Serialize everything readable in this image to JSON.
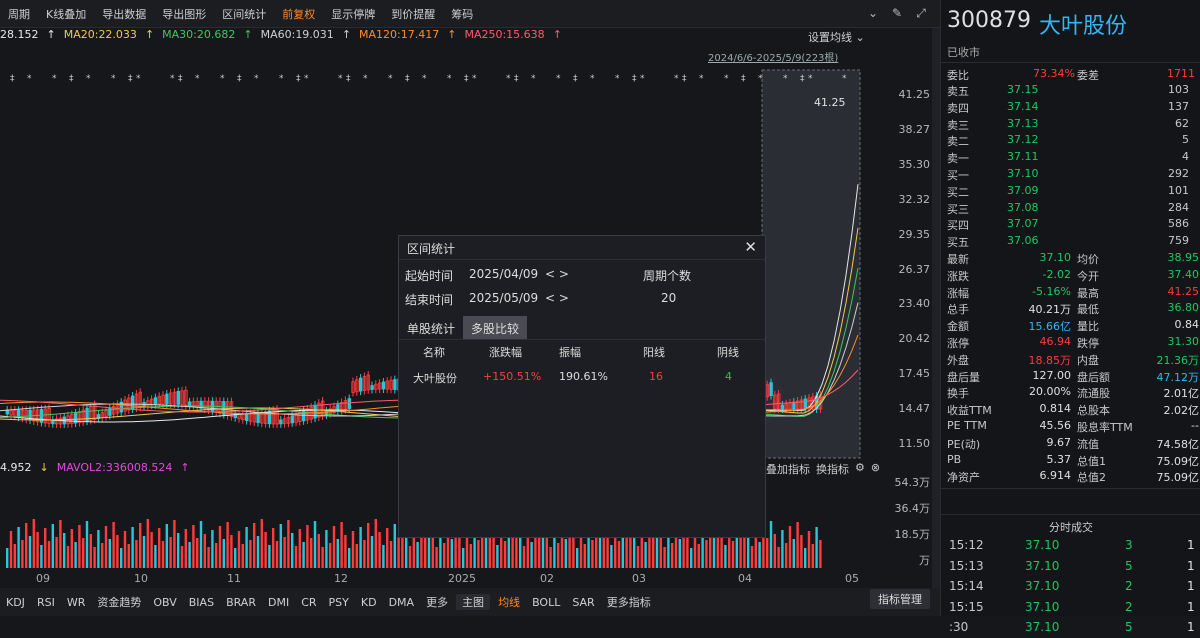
{
  "toolbar": {
    "items": [
      "周期",
      "K线叠加",
      "导出数据",
      "导出图形",
      "区间统计",
      "前复权",
      "显示停牌",
      "到价提醒",
      "筹码"
    ],
    "active_index": 5
  },
  "ma": [
    {
      "label": ":28.152",
      "color": "#e8e8e8"
    },
    {
      "label": "↑ MA20:22.033",
      "color": "#f2c94c"
    },
    {
      "label": "↑ MA30:20.682",
      "color": "#e24bd8"
    },
    {
      "label": "↑ MA30:20.682",
      "color": "#3ec95c"
    },
    {
      "label": "↑ MA60:19.031",
      "color": "#d0d0d0"
    },
    {
      "label": "↑ MA120:17.417",
      "color": "#ff8c2b"
    },
    {
      "label": "↑ MA250:15.638",
      "color": "#ff5a6a"
    }
  ],
  "ma_display": [
    {
      "text": "28.152",
      "color": "#e8e8e8",
      "arrow": "↑"
    },
    {
      "text": "MA20:22.033",
      "color": "#f2c94c",
      "arrow": "↑"
    },
    {
      "text": "MA30:20.682",
      "color": "#3ec95c",
      "arrow": "↑"
    },
    {
      "text": "MA60:19.031",
      "color": "#d0d0d0",
      "arrow": "↑"
    },
    {
      "text": "MA120:17.417",
      "color": "#ff8c2b",
      "arrow": "↑"
    },
    {
      "text": "MA250:15.638",
      "color": "#ff5a6a",
      "arrow": "↑"
    }
  ],
  "set_ma_label": "设置均线",
  "range_label": "2024/6/6-2025/5/9(223根)",
  "price_ticks": [
    "41.25",
    "38.27",
    "35.30",
    "32.32",
    "29.35",
    "26.37",
    "23.40",
    "20.42",
    "17.45",
    "14.47",
    "11.50"
  ],
  "max_label": "41.25",
  "vol": {
    "left_value": "4.952",
    "mavol2": "MAVOL2:336008.524",
    "ticks": [
      "54.3万",
      "36.4万",
      "18.5万",
      "万"
    ],
    "ctrl_a": "叠加指标",
    "ctrl_b": "换指标"
  },
  "dates": [
    "09",
    "10",
    "11",
    "12",
    "2025",
    "02",
    "03",
    "04",
    "05"
  ],
  "indicators": [
    "KDJ",
    "RSI",
    "WR",
    "资金趋势",
    "OBV",
    "BIAS",
    "BRAR",
    "DMI",
    "CR",
    "PSY",
    "KD",
    "DMA",
    "更多",
    "主图",
    "均线",
    "BOLL",
    "SAR",
    "更多指标"
  ],
  "indicator_active": "均线",
  "indicator_mgr": "指标管理",
  "dialog": {
    "title": "区间统计",
    "start_label": "起始时间",
    "start_value": "2025/04/09",
    "end_label": "结束时间",
    "end_value": "2025/05/09",
    "arrows": "< >",
    "period_label": "周期个数",
    "period_value": "20",
    "tab_single": "单股统计",
    "tab_multi": "多股比较",
    "headers": [
      "名称",
      "涨跌幅",
      "振幅",
      "阳线",
      "阴线"
    ],
    "row": [
      "大叶股份",
      "+150.51%",
      "190.61%",
      "16",
      "4"
    ]
  },
  "stock": {
    "code": "300879",
    "name": "大叶股份",
    "status": "已收市"
  },
  "quote": {
    "webi_label": "委比",
    "webi": "73.34%",
    "wecha_label": "委差",
    "wecha": "1711",
    "asks": [
      {
        "label": "卖五",
        "price": "37.15",
        "vol": "103"
      },
      {
        "label": "卖四",
        "price": "37.14",
        "vol": "137"
      },
      {
        "label": "卖三",
        "price": "37.13",
        "vol": "62"
      },
      {
        "label": "卖二",
        "price": "37.12",
        "vol": "5"
      },
      {
        "label": "卖一",
        "price": "37.11",
        "vol": "4"
      }
    ],
    "bids": [
      {
        "label": "买一",
        "price": "37.10",
        "vol": "292"
      },
      {
        "label": "买二",
        "price": "37.09",
        "vol": "101"
      },
      {
        "label": "买三",
        "price": "37.08",
        "vol": "284"
      },
      {
        "label": "买四",
        "price": "37.07",
        "vol": "586"
      },
      {
        "label": "买五",
        "price": "37.06",
        "vol": "759"
      }
    ],
    "stats": [
      {
        "l1": "最新",
        "v1": "37.10",
        "c1": "green",
        "l2": "均价",
        "v2": "38.95",
        "c2": "green"
      },
      {
        "l1": "涨跌",
        "v1": "-2.02",
        "c1": "green",
        "l2": "今开",
        "v2": "37.40",
        "c2": "green"
      },
      {
        "l1": "涨幅",
        "v1": "-5.16%",
        "c1": "green",
        "l2": "最高",
        "v2": "41.25",
        "c2": "red"
      },
      {
        "l1": "总手",
        "v1": "40.21万",
        "c1": "white",
        "l2": "最低",
        "v2": "36.80",
        "c2": "green"
      },
      {
        "l1": "金额",
        "v1": "15.66亿",
        "c1": "cyan",
        "l2": "量比",
        "v2": "0.84",
        "c2": "white"
      },
      {
        "l1": "涨停",
        "v1": "46.94",
        "c1": "red",
        "l2": "跌停",
        "v2": "31.30",
        "c2": "green"
      },
      {
        "l1": "外盘",
        "v1": "18.85万",
        "c1": "red",
        "l2": "内盘",
        "v2": "21.36万",
        "c2": "green"
      },
      {
        "l1": "盘后量",
        "v1": "127.00",
        "c1": "white",
        "l2": "盘后额",
        "v2": "47.12万",
        "c2": "cyan"
      },
      {
        "l1": "换手",
        "v1": "20.00%",
        "c1": "white",
        "l2": "流通股",
        "v2": "2.01亿",
        "c2": "white"
      },
      {
        "l1": "收益TTM",
        "v1": "0.814",
        "c1": "white",
        "l2": "总股本",
        "v2": "2.02亿",
        "c2": "white"
      },
      {
        "l1": "PE TTM",
        "v1": "45.56",
        "c1": "white",
        "l2": "股息率TTM",
        "v2": "--",
        "c2": "white"
      },
      {
        "l1": "PE(动)",
        "v1": "9.67",
        "c1": "white",
        "l2": "流值",
        "v2": "74.58亿",
        "c2": "white"
      },
      {
        "l1": "PB",
        "v1": "5.37",
        "c1": "white",
        "l2": "总值1",
        "v2": "75.09亿",
        "c2": "white"
      },
      {
        "l1": "净资产",
        "v1": "6.914",
        "c1": "white",
        "l2": "总值2",
        "v2": "75.09亿",
        "c2": "white"
      }
    ]
  },
  "trades_title": "分时成交",
  "trades": [
    {
      "time": "15:12",
      "price": "37.10",
      "vol": "3",
      "n": "1"
    },
    {
      "time": "15:13",
      "price": "37.10",
      "vol": "5",
      "n": "1"
    },
    {
      "time": "15:14",
      "price": "37.10",
      "vol": "2",
      "n": "1"
    },
    {
      "time": "15:15",
      "price": "37.10",
      "vol": "2",
      "n": "1"
    },
    {
      "time": ":30",
      "price": "37.10",
      "vol": "5",
      "n": "1"
    }
  ]
}
